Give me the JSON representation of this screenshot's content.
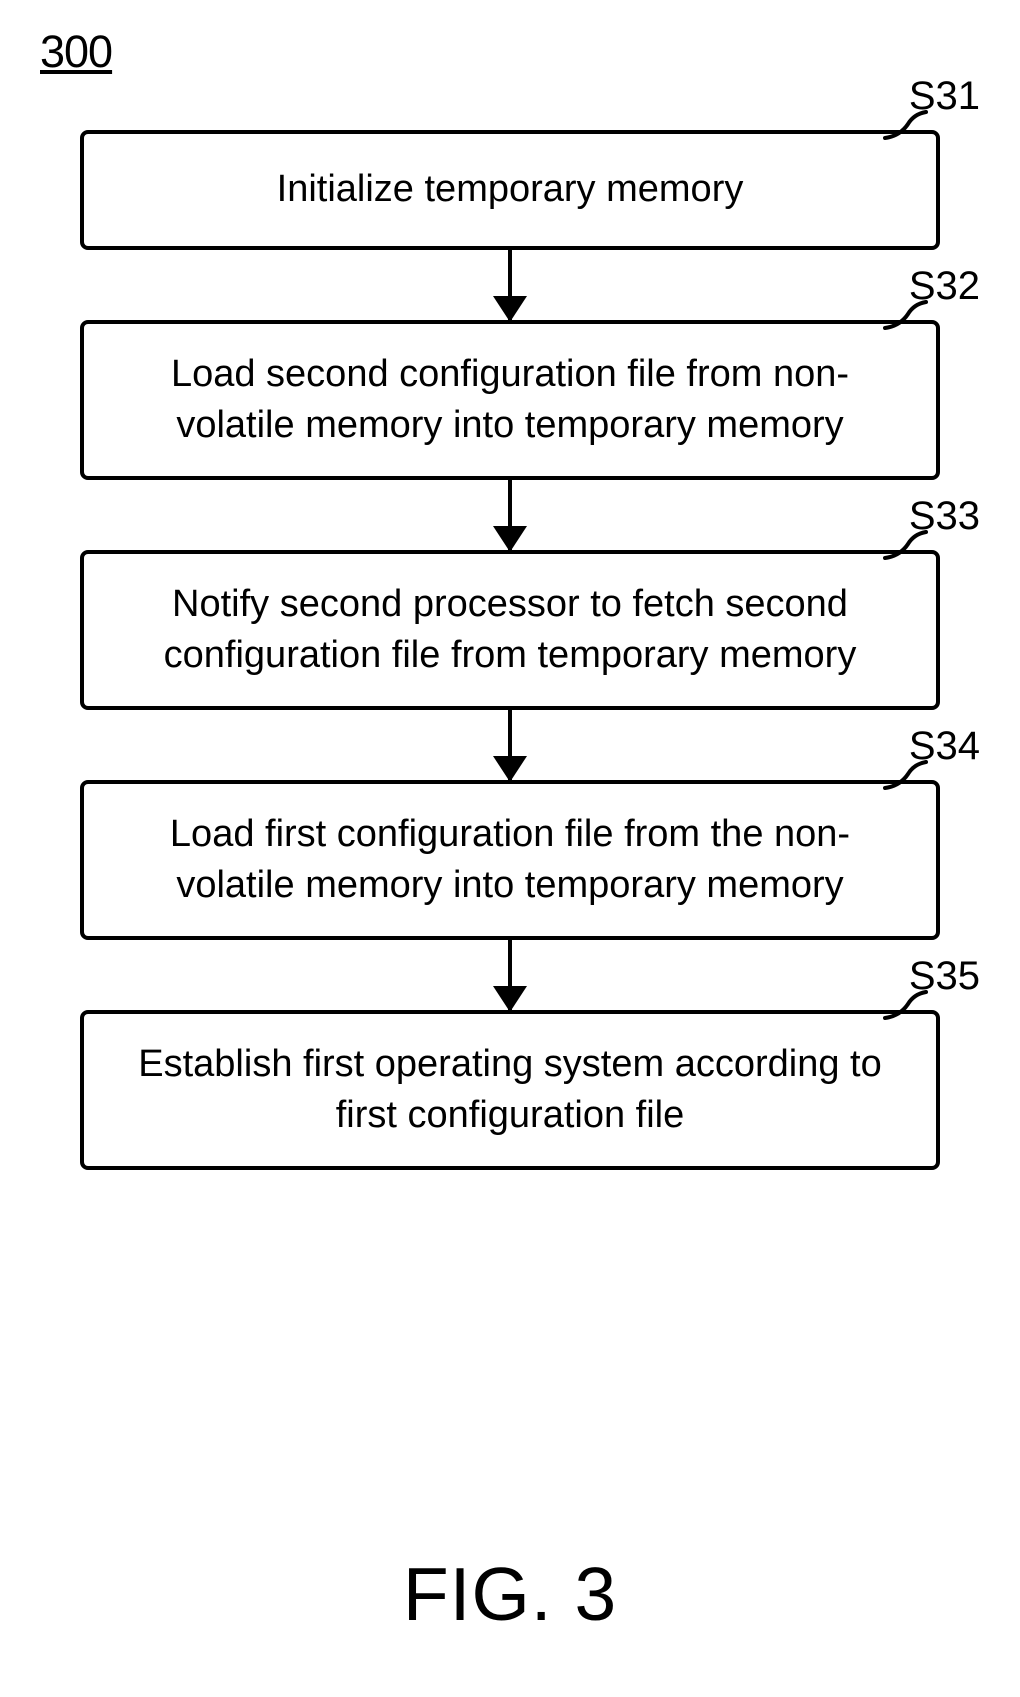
{
  "diagram": {
    "figure_number": "300",
    "caption": "FIG. 3",
    "steps": [
      {
        "label": "S31",
        "text": "Initialize temporary memory"
      },
      {
        "label": "S32",
        "text": "Load second configuration file from non-volatile memory into temporary memory"
      },
      {
        "label": "S33",
        "text": "Notify second processor to fetch second configuration file from temporary memory"
      },
      {
        "label": "S34",
        "text": "Load first configuration file from the non-volatile memory into temporary memory"
      },
      {
        "label": "S35",
        "text": "Establish first operating system according to first configuration file"
      }
    ]
  }
}
